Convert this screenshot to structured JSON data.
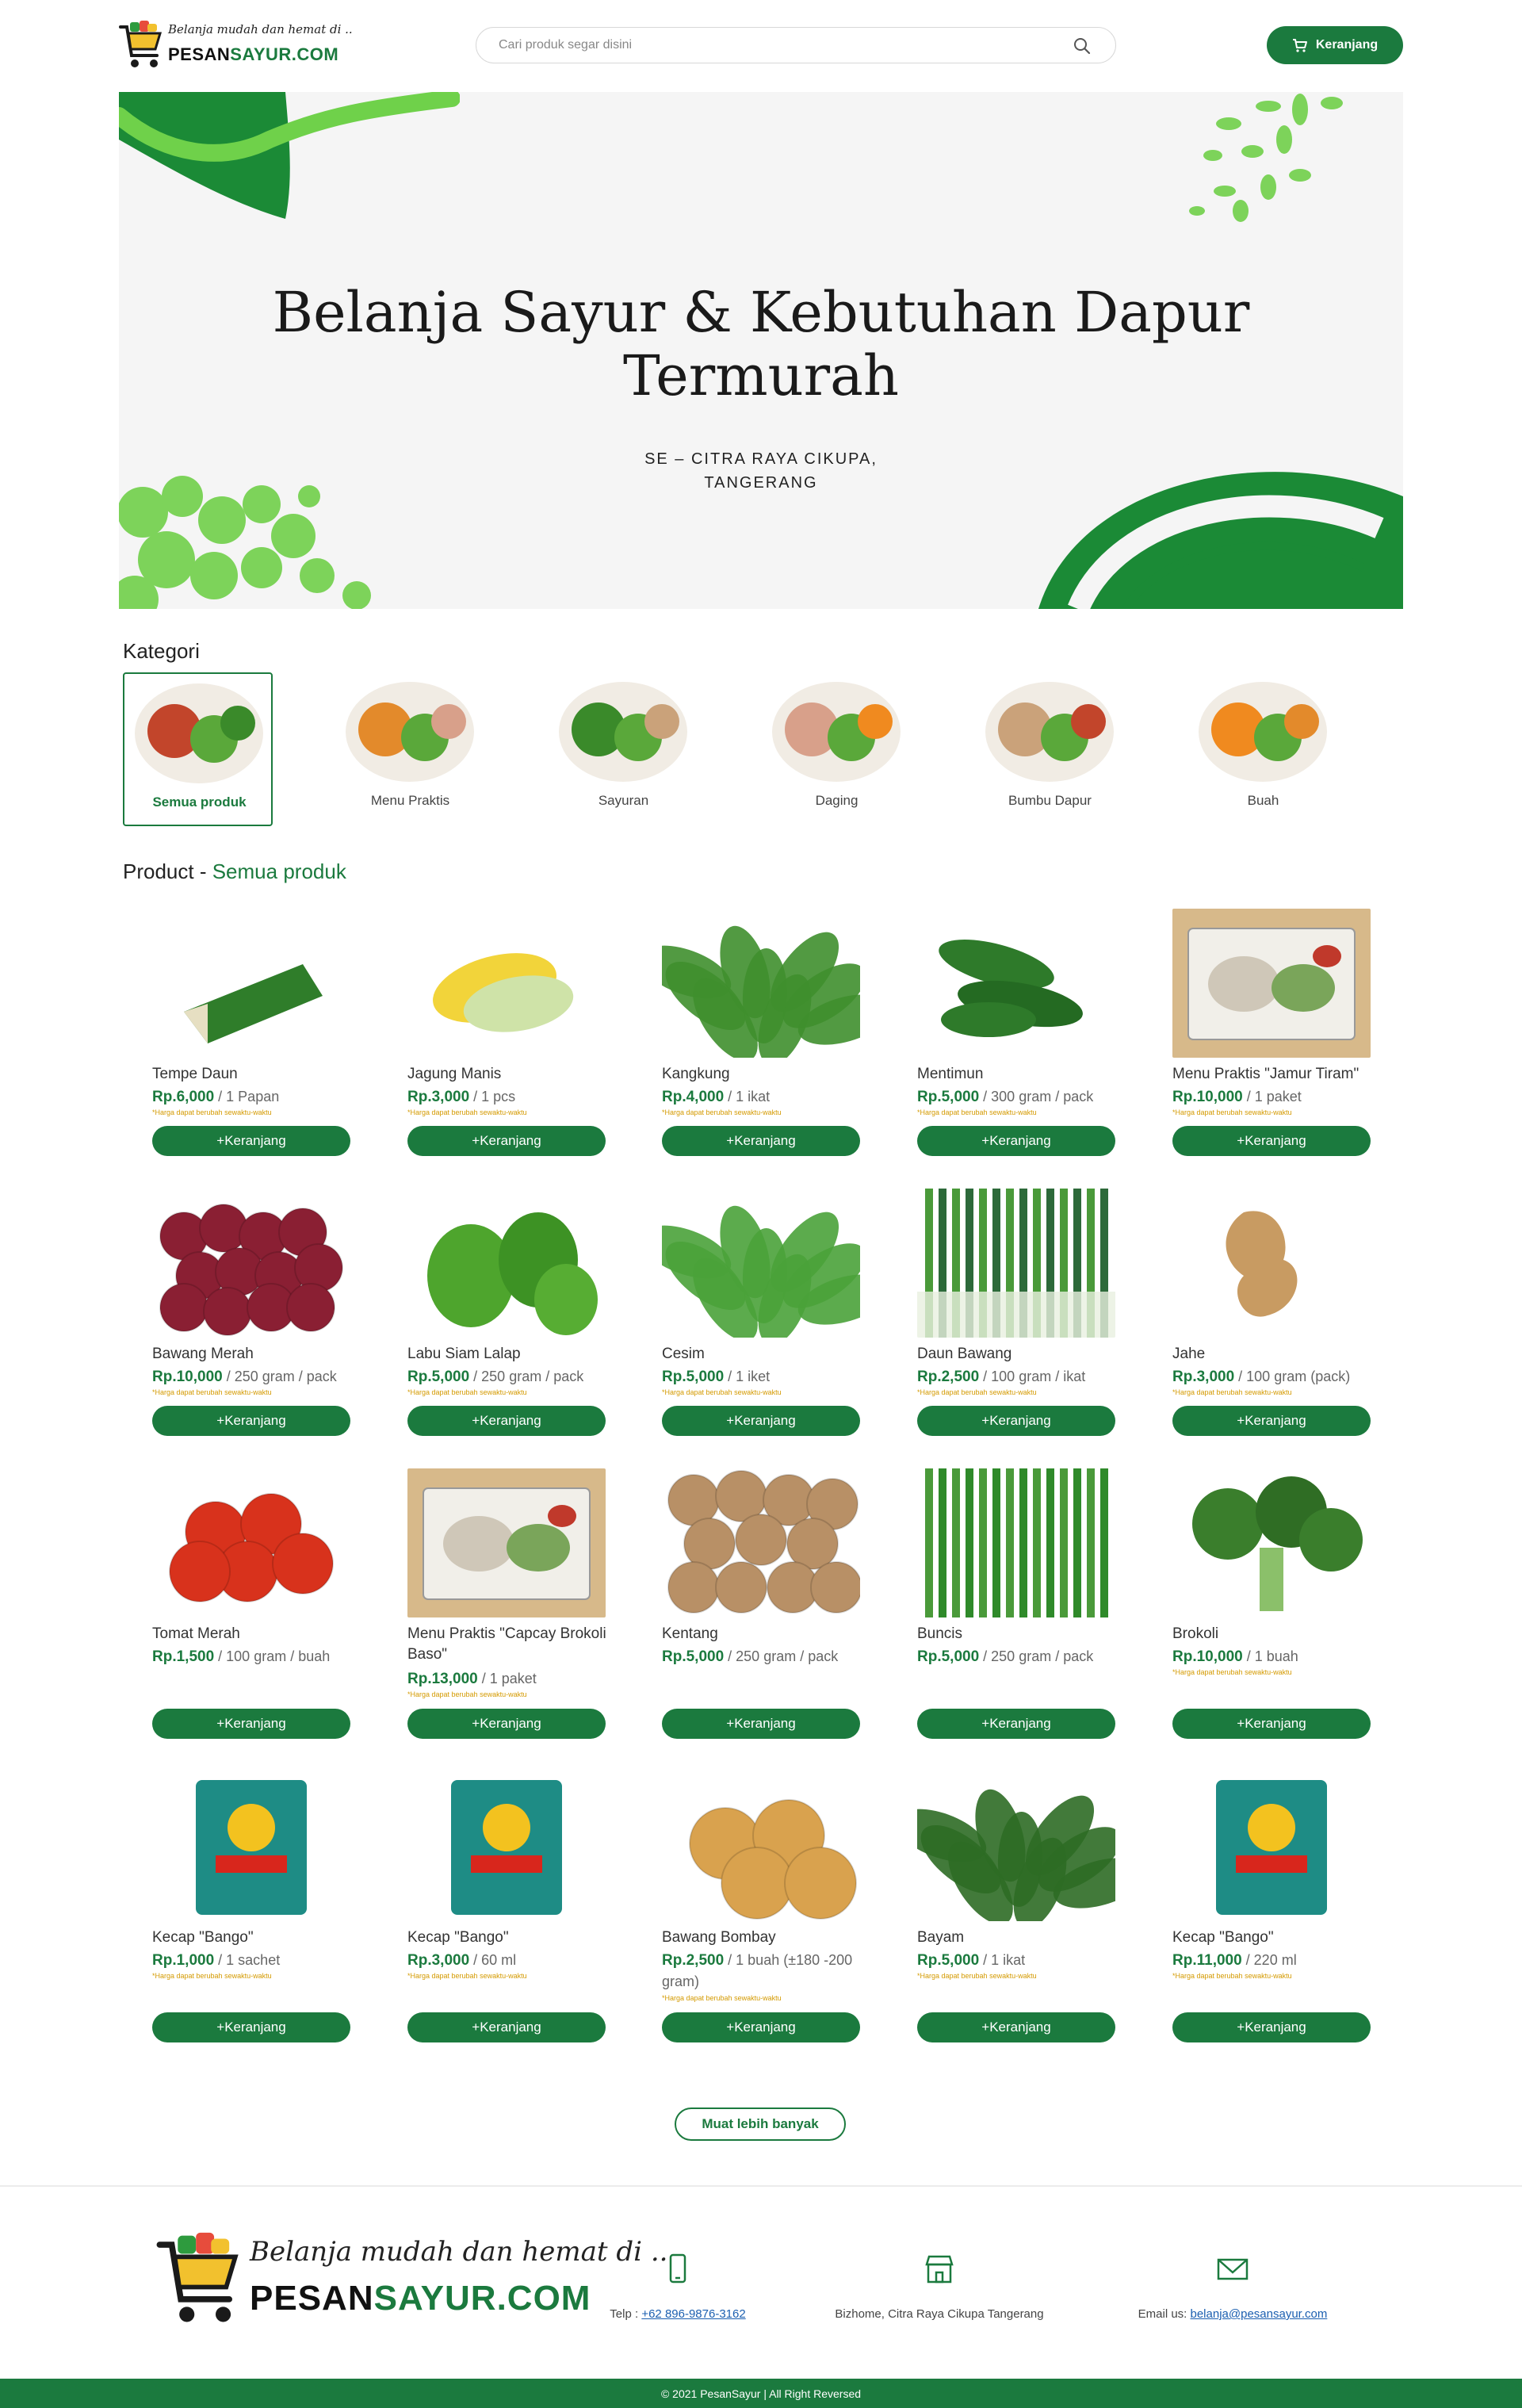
{
  "header": {
    "tagline": "Belanja mudah dan hemat di ..",
    "brand_dark": "PESAN",
    "brand_green": "SAYUR.COM",
    "search_placeholder": "Cari produk segar disini",
    "cart_label": "Keranjang"
  },
  "hero": {
    "title_line1": "Belanja Sayur & Kebutuhan Dapur",
    "title_line2": "Termurah",
    "sub_line1": "SE – CITRA RAYA CIKUPA,",
    "sub_line2": "TANGERANG"
  },
  "categories": {
    "title": "Kategori",
    "items": [
      {
        "label": "Semua produk",
        "active": true,
        "icon": "mixed-produce"
      },
      {
        "label": "Menu Praktis",
        "active": false,
        "icon": "meal-pack"
      },
      {
        "label": "Sayuran",
        "active": false,
        "icon": "vegetables"
      },
      {
        "label": "Daging",
        "active": false,
        "icon": "meat"
      },
      {
        "label": "Bumbu Dapur",
        "active": false,
        "icon": "spices"
      },
      {
        "label": "Buah",
        "active": false,
        "icon": "fruit"
      }
    ]
  },
  "products": {
    "title_prefix": "Product - ",
    "title_accent": "Semua produk",
    "note": "*Harga dapat berubah sewaktu-waktu",
    "add_label": "+Keranjang",
    "items": [
      {
        "name": "Tempe Daun",
        "price": "Rp.6,000",
        "unit": " / 1 Papan",
        "note": true,
        "img": "tempe",
        "color": "#2f7d2a"
      },
      {
        "name": "Jagung Manis",
        "price": "Rp.3,000",
        "unit": " / 1 pcs",
        "note": true,
        "img": "corn",
        "color": "#f2d43a"
      },
      {
        "name": "Kangkung",
        "price": "Rp.4,000",
        "unit": " / 1 ikat",
        "note": true,
        "img": "leafy",
        "color": "#3f8f2e"
      },
      {
        "name": "Mentimun",
        "price": "Rp.5,000",
        "unit": " / 300 gram / pack",
        "note": true,
        "img": "cucumber",
        "color": "#2e7a2a"
      },
      {
        "name": "Menu Praktis \"Jamur Tiram\"",
        "price": "Rp.10,000",
        "unit": " / 1 paket",
        "note": true,
        "img": "pack",
        "color": "#e9e3d6"
      },
      {
        "name": "Bawang Merah",
        "price": "Rp.10,000",
        "unit": " / 250 gram / pack",
        "note": true,
        "img": "shallot",
        "color": "#8a1f33"
      },
      {
        "name": "Labu Siam Lalap",
        "price": "Rp.5,000",
        "unit": " / 250 gram / pack",
        "note": true,
        "img": "chayote",
        "color": "#4ea52d"
      },
      {
        "name": "Cesim",
        "price": "Rp.5,000",
        "unit": " / 1 iket",
        "note": true,
        "img": "leafy",
        "color": "#4aa23a"
      },
      {
        "name": "Daun Bawang",
        "price": "Rp.2,500",
        "unit": " / 100 gram / ikat",
        "note": true,
        "img": "scallion",
        "color": "#2d6a3a"
      },
      {
        "name": "Jahe",
        "price": "Rp.3,000",
        "unit": " / 100 gram (pack)",
        "note": true,
        "img": "ginger",
        "color": "#c89b62"
      },
      {
        "name": "Tomat Merah",
        "price": "Rp.1,500",
        "unit": " / 100 gram / buah",
        "note": false,
        "img": "tomato",
        "color": "#d8321c"
      },
      {
        "name": "Menu Praktis \"Capcay Brokoli Baso\"",
        "price": "Rp.13,000",
        "unit": " / 1 paket",
        "note": true,
        "img": "pack",
        "color": "#e9e3d6"
      },
      {
        "name": "Kentang",
        "price": "Rp.5,000",
        "unit": " / 250 gram / pack",
        "note": false,
        "img": "potato",
        "color": "#b89066"
      },
      {
        "name": "Buncis",
        "price": "Rp.5,000",
        "unit": " / 250 gram / pack",
        "note": false,
        "img": "beans",
        "color": "#2f8a2a"
      },
      {
        "name": "Brokoli",
        "price": "Rp.10,000",
        "unit": " / 1 buah",
        "note": true,
        "img": "broccoli",
        "color": "#3a7e2c"
      },
      {
        "name": "Kecap \"Bango\"",
        "price": "Rp.1,000",
        "unit": " / 1 sachet",
        "note": true,
        "img": "bango",
        "color": "#1e8c85"
      },
      {
        "name": "Kecap \"Bango\"",
        "price": "Rp.3,000",
        "unit": " / 60 ml",
        "note": true,
        "img": "bango",
        "color": "#1e8c85"
      },
      {
        "name": "Bawang Bombay",
        "price": "Rp.2,500",
        "unit": " / 1 buah (±180 -200 gram)",
        "note": true,
        "img": "onion",
        "color": "#d9a24e"
      },
      {
        "name": "Bayam",
        "price": "Rp.5,000",
        "unit": " / 1 ikat",
        "note": true,
        "img": "spinach",
        "color": "#2d6b25"
      },
      {
        "name": "Kecap \"Bango\"",
        "price": "Rp.11,000",
        "unit": " / 220 ml",
        "note": true,
        "img": "bango",
        "color": "#1e8c85"
      }
    ],
    "load_more": "Muat lebih banyak"
  },
  "footer": {
    "tagline": "Belanja mudah dan hemat di ..",
    "brand_dark": "PESAN",
    "brand_green": "SAYUR.COM",
    "phone_label": "Telp : ",
    "phone": "+62 896-9876-3162",
    "address": "Bizhome, Citra Raya Cikupa Tangerang",
    "email_label": "Email us: ",
    "email": "belanja@pesansayur.com",
    "copyright": "© 2021 PesanSayur | All Right Reversed"
  },
  "colors": {
    "brand_green": "#1b7a3e",
    "leaf_green": "#7dd35a",
    "accent_yellow": "#d49a00"
  }
}
